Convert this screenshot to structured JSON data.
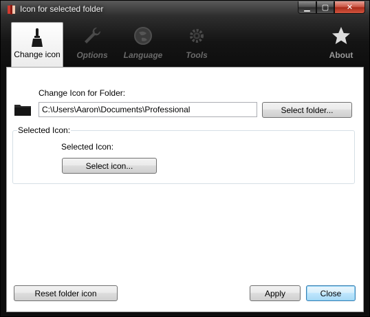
{
  "window": {
    "title": "Icon for selected folder",
    "controls": {
      "minimize": "▁",
      "maximize": "▢",
      "close": "✕"
    }
  },
  "toolbar": {
    "tabs": [
      {
        "label": "Change icon",
        "icon": "paintbrush-icon",
        "active": true
      },
      {
        "label": "Options",
        "icon": "wrench-icon",
        "active": false
      },
      {
        "label": "Language",
        "icon": "globe-icon",
        "active": false
      },
      {
        "label": "Tools",
        "icon": "gear-icon",
        "active": false
      },
      {
        "label": "About",
        "icon": "star-icon",
        "active": false
      }
    ]
  },
  "main": {
    "change_icon_label": "Change Icon for Folder:",
    "folder_path": "C:\\Users\\Aaron\\Documents\\Professional",
    "select_folder_button": "Select folder...",
    "group_title": "Selected Icon:",
    "selected_icon_label": "Selected Icon:",
    "select_icon_button": "Select icon..."
  },
  "footer": {
    "reset_button": "Reset folder icon",
    "apply_button": "Apply",
    "close_button": "Close"
  },
  "colors": {
    "title_bar": "#2e2e2e",
    "close_button": "#c7503d",
    "default_button_border": "#3c7fb1"
  }
}
